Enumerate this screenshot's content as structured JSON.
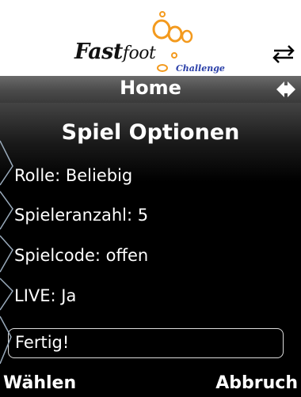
{
  "header": {
    "logo_main": "Fast",
    "logo_foot": "foot",
    "logo_sub": "Challenge",
    "swap_icon": "swap-arrows-icon"
  },
  "navbar": {
    "title": "Home",
    "nav_icon": "left-right-arrows-icon"
  },
  "screen": {
    "title": "Spiel Optionen",
    "options": [
      {
        "label": "Rolle: Beliebig"
      },
      {
        "label": "Spieleranzahl: 5"
      },
      {
        "label": "Spielcode: offen"
      },
      {
        "label": "LIVE: Ja"
      }
    ],
    "done_button": "Fertig!"
  },
  "softkeys": {
    "left": "Wählen",
    "right": "Abbruch"
  },
  "colors": {
    "background": "#000000",
    "text": "#ffffff",
    "logo_orange": "#f39a1e",
    "logo_blue": "#2a3fa8"
  }
}
